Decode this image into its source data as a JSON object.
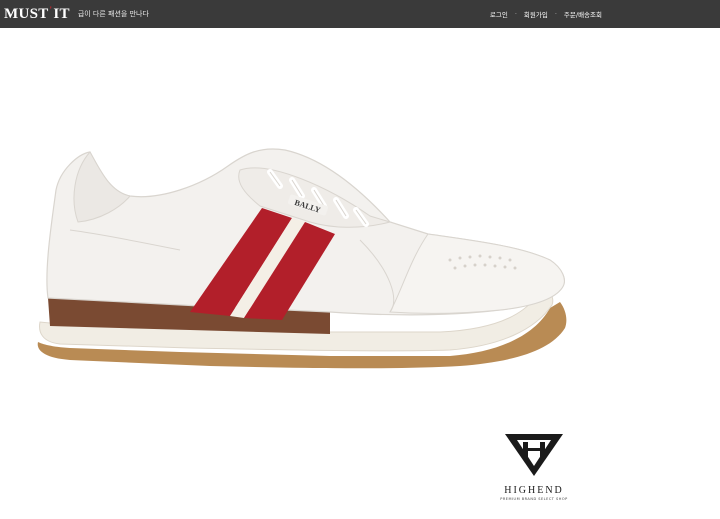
{
  "header": {
    "logo_left": "MUST",
    "logo_accent": "'",
    "logo_right": "IT",
    "tagline": "급이 다른 패션을 만나다",
    "nav": [
      {
        "label": "로그인"
      },
      {
        "label": "회원가입"
      },
      {
        "label": "주문/배송조회"
      }
    ]
  },
  "product": {
    "brand_on_shoe": "BALLY",
    "colors": {
      "upper": "#f3f1ee",
      "stripe_red": "#b21f2a",
      "stripe_white": "#f4efe6",
      "midsole": "#7a4a32",
      "outsole": "#f1ede4",
      "gum": "#b98b54"
    }
  },
  "watermark": {
    "word": "HIGHEND",
    "sub": "PREMIUM BRAND SELECT SHOP"
  }
}
